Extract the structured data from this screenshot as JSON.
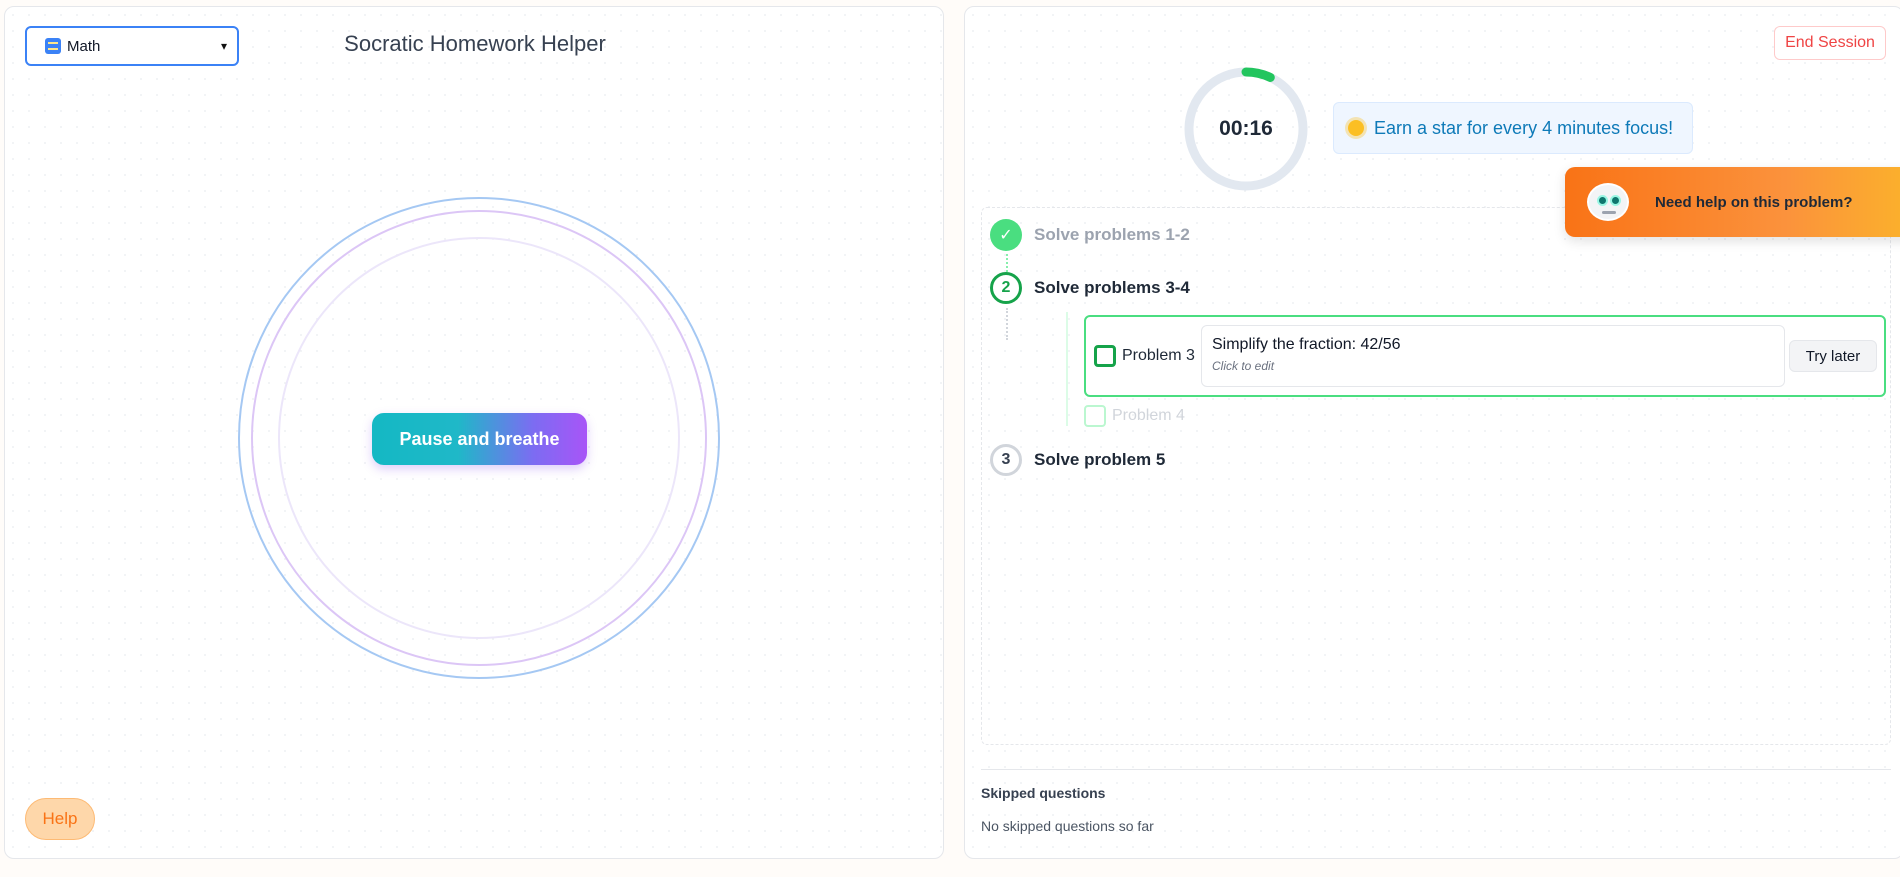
{
  "left": {
    "subject_select": {
      "icon": "abacus-icon",
      "value": "Math"
    },
    "app_title": "Socratic Homework Helper",
    "breathe_button": "Pause and breathe",
    "help_button": "Help"
  },
  "right": {
    "end_session": "End Session",
    "timer": {
      "display": "00:16",
      "progress": 0.07
    },
    "star_banner": {
      "icon": "sun-icon",
      "text": "Earn a star for every 4 minutes focus!"
    },
    "help_toast": {
      "icon": "robot-icon",
      "text": "Need help on this problem?"
    },
    "steps": [
      {
        "number": "✓",
        "title": "Solve problems 1-2",
        "status": "done"
      },
      {
        "number": "2",
        "title": "Solve problems 3-4",
        "status": "active"
      },
      {
        "number": "3",
        "title": "Solve problem 5",
        "status": "pending"
      }
    ],
    "current_problem": {
      "label": "Problem 3",
      "text": "Simplify the fraction: 42/56",
      "edit_hint": "Click to edit",
      "try_later": "Try later"
    },
    "next_problem": {
      "label": "Problem 4"
    },
    "skipped": {
      "title": "Skipped questions",
      "empty_text": "No skipped questions so far"
    }
  },
  "colors": {
    "accent_blue": "#3b82f6",
    "success_green": "#16a34a",
    "danger_red": "#ef4444",
    "toast_orange": "#f97316",
    "banner_blue": "#0e7ab8"
  }
}
